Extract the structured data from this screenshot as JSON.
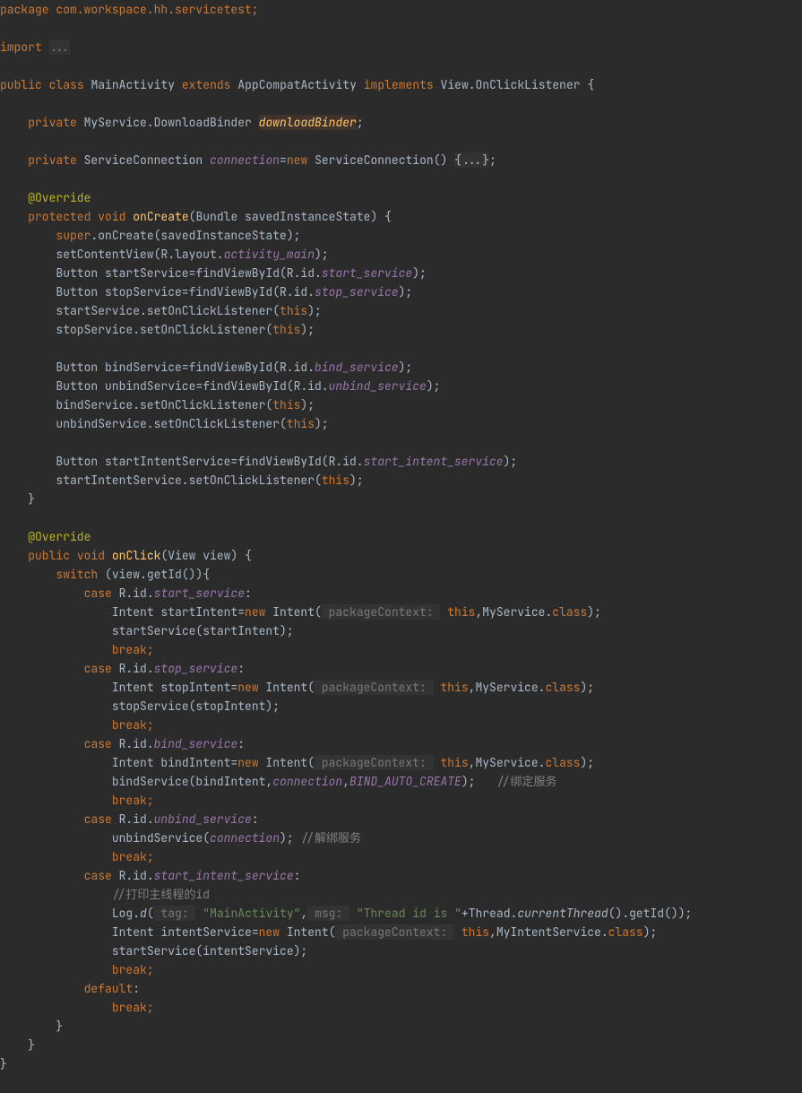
{
  "package_line": "package com.workspace.hh.servicetest;",
  "import_word": "import",
  "import_dots": "...",
  "class_header": {
    "public": "public",
    "class": "class",
    "name": "MainActivity",
    "extends": "extends",
    "parent": "AppCompatActivity",
    "implements": "implements",
    "impl": "View.OnClickListener {"
  },
  "field1": {
    "private": "private",
    "type": "MyService.DownloadBinder",
    "name": "downloadBinder",
    "semi": ";"
  },
  "field2": {
    "private": "private",
    "type": "ServiceConnection",
    "name": "connection",
    "eq": "=",
    "new": "new",
    "ctor": "ServiceConnection()",
    "body": "{...}",
    "semi": ";"
  },
  "override": "@Override",
  "on_create": {
    "protected": "protected",
    "void": "void",
    "name": "onCreate",
    "params": "(Bundle savedInstanceState) {"
  },
  "super_keyword": "super",
  "super_call": ".onCreate(savedInstanceState);",
  "setcontentview_head": "setContentView(R.layout.",
  "setcontentview_field": "activity_main",
  "setcontentview_tail": ");",
  "btn_start": {
    "decl": "Button startService=findViewById(R.id.",
    "field": "start_service",
    "tail": ");"
  },
  "btn_stop": {
    "decl": "Button stopService=findViewById(R.id.",
    "field": "stop_service",
    "tail": ");"
  },
  "startService_listener_head": "startService.setOnClickListener(",
  "stopService_listener_head": "stopService.setOnClickListener(",
  "this": "this",
  "close_paren_semi": ");",
  "btn_bind": {
    "decl": "Button bindService=findViewById(R.id.",
    "field": "bind_service",
    "tail": ");"
  },
  "btn_unbind": {
    "decl": "Button unbindService=findViewById(R.id.",
    "field": "unbind_service",
    "tail": ");"
  },
  "bindService_listener_head": "bindService.setOnClickListener(",
  "unbindService_listener_head": "unbindService.setOnClickListener(",
  "btn_intent": {
    "decl": "Button startIntentService=findViewById(R.id.",
    "field": "start_intent_service",
    "tail": ");"
  },
  "intentService_listener_head": "startIntentService.setOnClickListener(",
  "close_method": "}",
  "on_click": {
    "public": "public",
    "void": "void",
    "name": "onClick",
    "params": "(View view) {"
  },
  "switch_kw": "switch",
  "switch_head": " (view.getId()){",
  "case_kw": "case",
  "rid": " R.id.",
  "case_colon": ":",
  "case_start": "start_service",
  "case_stop": "stop_service",
  "case_bind": "bind_service",
  "case_unbind": "unbind_service",
  "case_intentservice": "start_intent_service",
  "intent_startIntent": "Intent startIntent=",
  "intent_stopIntent": "Intent stopIntent=",
  "intent_bindIntent": "Intent bindIntent=",
  "intent_intentService": "Intent intentService=",
  "new_kw": "new",
  "intent_open": " Intent(",
  "pkg_hint": " packageContext: ",
  "intent_target_myservice": ",MyService.",
  "intent_target_myintentservice": ",MyIntentService.",
  "class_kw": "class",
  "intent_close": ");",
  "startService_startIntent": "startService(startIntent);",
  "stopService_stopIntent": "stopService(stopIntent);",
  "bindService_head": "bindService(bindIntent,",
  "bindService_conn": "connection",
  "bindService_comma": ",",
  "bindService_flag": "BIND_AUTO_CREATE",
  "bindService_tail": ");",
  "bind_comment": "   //绑定服务",
  "unbindService_head": "unbindService(",
  "unbindService_tail": "); ",
  "unbind_comment": "//解绑服务",
  "startService_intentService": "startService(intentService);",
  "comment_threadid": "//打印主线程的id",
  "log_head": "Log.",
  "log_d": "d",
  "log_open": "(",
  "log_tag_hint": " tag: ",
  "log_tag_str": "\"MainActivity\"",
  "log_comma": ",",
  "log_msg_hint": " msg: ",
  "log_msg_str": "\"Thread id is \"",
  "log_plus": "+Thread.",
  "log_currentThread": "currentThread",
  "log_tail": "().getId());",
  "break_kw": "break;",
  "default_kw": "default",
  "close_brace": "}"
}
